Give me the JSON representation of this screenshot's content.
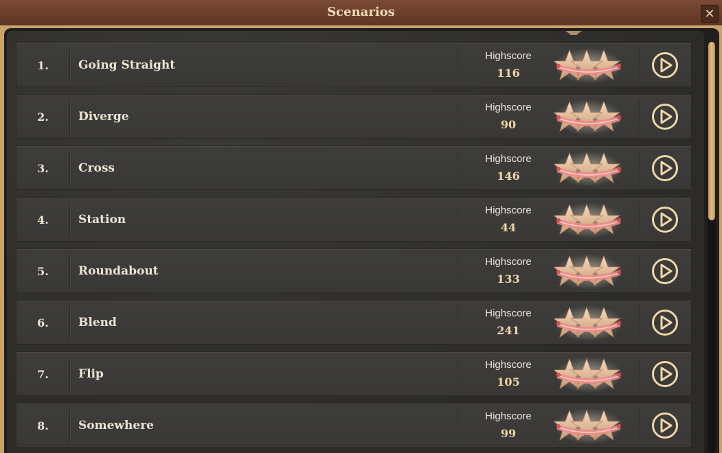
{
  "window": {
    "title": "Scenarios",
    "close_label": "✕"
  },
  "highscore_label": "Highscore",
  "scenarios": [
    {
      "number": "1.",
      "name": "Going Straight",
      "highscore": "116",
      "stars": 3
    },
    {
      "number": "2.",
      "name": "Diverge",
      "highscore": "90",
      "stars": 3
    },
    {
      "number": "3.",
      "name": "Cross",
      "highscore": "146",
      "stars": 3
    },
    {
      "number": "4.",
      "name": "Station",
      "highscore": "44",
      "stars": 3
    },
    {
      "number": "5.",
      "name": "Roundabout",
      "highscore": "133",
      "stars": 3
    },
    {
      "number": "6.",
      "name": "Blend",
      "highscore": "241",
      "stars": 3
    },
    {
      "number": "7.",
      "name": "Flip",
      "highscore": "105",
      "stars": 3
    },
    {
      "number": "8.",
      "name": "Somewhere",
      "highscore": "99",
      "stars": 3
    }
  ],
  "icons": {
    "close": "close-icon",
    "play": "play-icon",
    "stars": "star-rating-icon"
  },
  "colors": {
    "titlebar": "#6a3e2b",
    "frame_gold": "#c9a36b",
    "row_bg": "#3b3a38",
    "text_light": "#ece3d3",
    "score_gold": "#efd7a8",
    "star_fill": "#e8c4a0",
    "ribbon": "#e86a6a"
  }
}
